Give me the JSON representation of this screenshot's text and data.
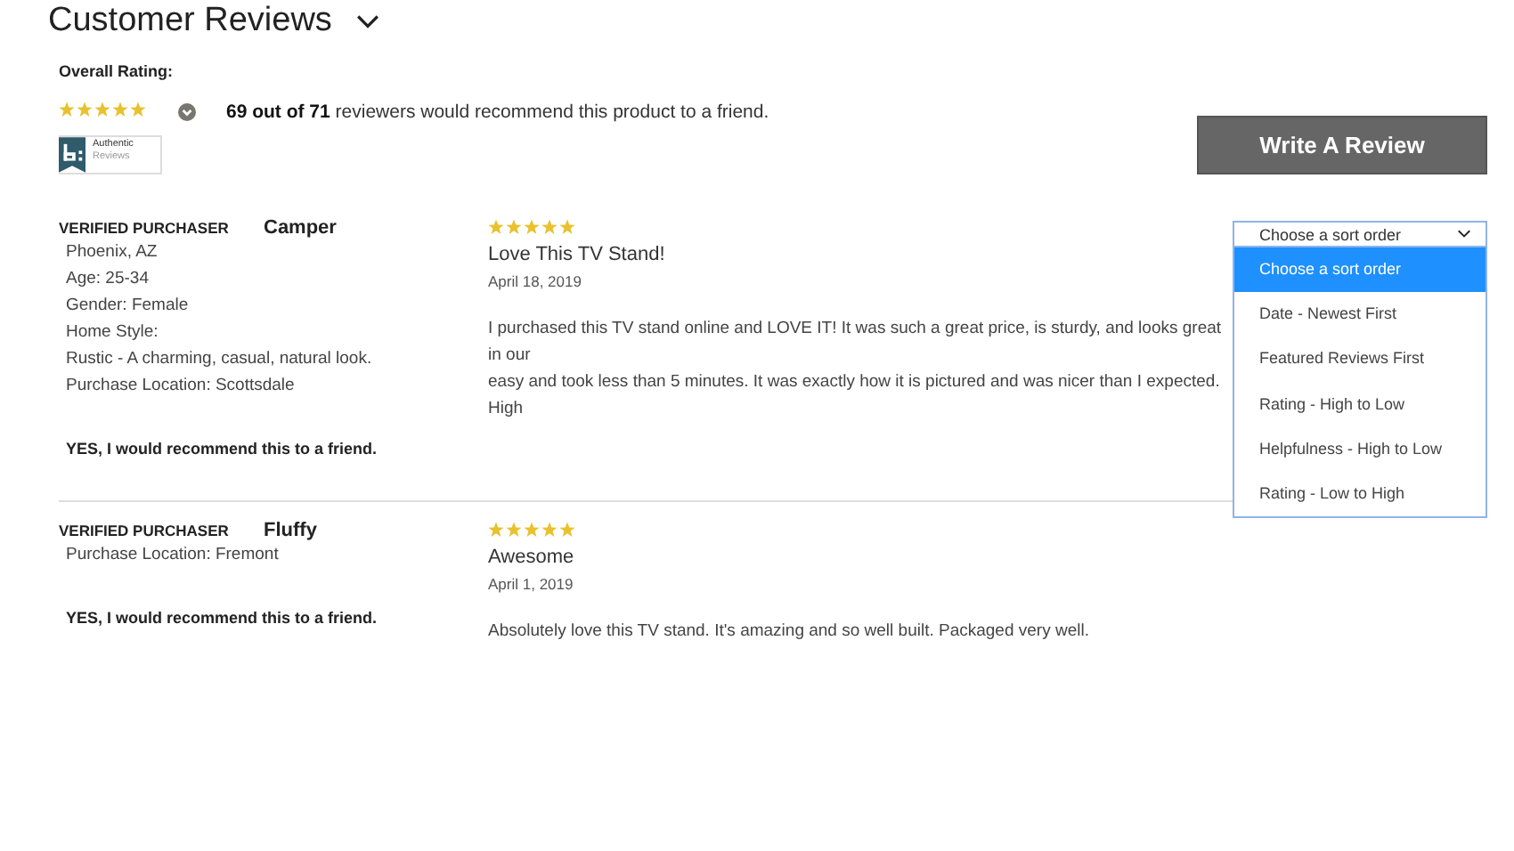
{
  "title": "Customer Reviews",
  "overall": {
    "label": "Overall Rating:",
    "stars": 5,
    "recommend": "**69 out of 71** reviewers would recommend this product to a friend.",
    "badge_top": "Authentic",
    "badge_bottom": "Reviews"
  },
  "write_button": "Write A Review",
  "sort": {
    "value": "Choose a sort order",
    "expanded": true,
    "options": [
      {
        "label": "Choose a sort order",
        "selected": true
      },
      {
        "label": "Date - Newest First",
        "selected": false
      },
      {
        "label": "Featured Reviews First",
        "selected": false
      },
      {
        "label": "Rating - High to Low",
        "selected": false
      },
      {
        "label": "Helpfulness - High to Low",
        "selected": false
      },
      {
        "label": "Rating - Low to High",
        "selected": false
      }
    ]
  },
  "reviews": [
    {
      "badge": "VERIFIED PURCHASER",
      "name": "Camper",
      "details": [
        "Phoenix, AZ",
        "Age: 25-34",
        "Gender: Female",
        "Home Style:",
        "Rustic - A charming, casual, natural look.",
        "Purchase Location: Scottsdale"
      ],
      "recommend": "YES, I would recommend this to a friend.",
      "stars": 5,
      "headline": "Love This TV Stand!",
      "date": "April 18, 2019",
      "body": [
        "I purchased this TV stand online and LOVE IT! It was such a great price, is sturdy, and looks great in our",
        "easy and took less than 5 minutes. It was exactly how it is pictured and was nicer than I expected. High"
      ]
    },
    {
      "badge": "VERIFIED PURCHASER",
      "name": "Fluffy",
      "details": [
        "Purchase Location: Fremont"
      ],
      "recommend": "YES, I would recommend this to a friend.",
      "stars": 5,
      "headline": "Awesome",
      "date": "April 1, 2019",
      "body": [
        "Absolutely love this TV stand. It's amazing and so well built. Packaged very well."
      ]
    }
  ]
}
